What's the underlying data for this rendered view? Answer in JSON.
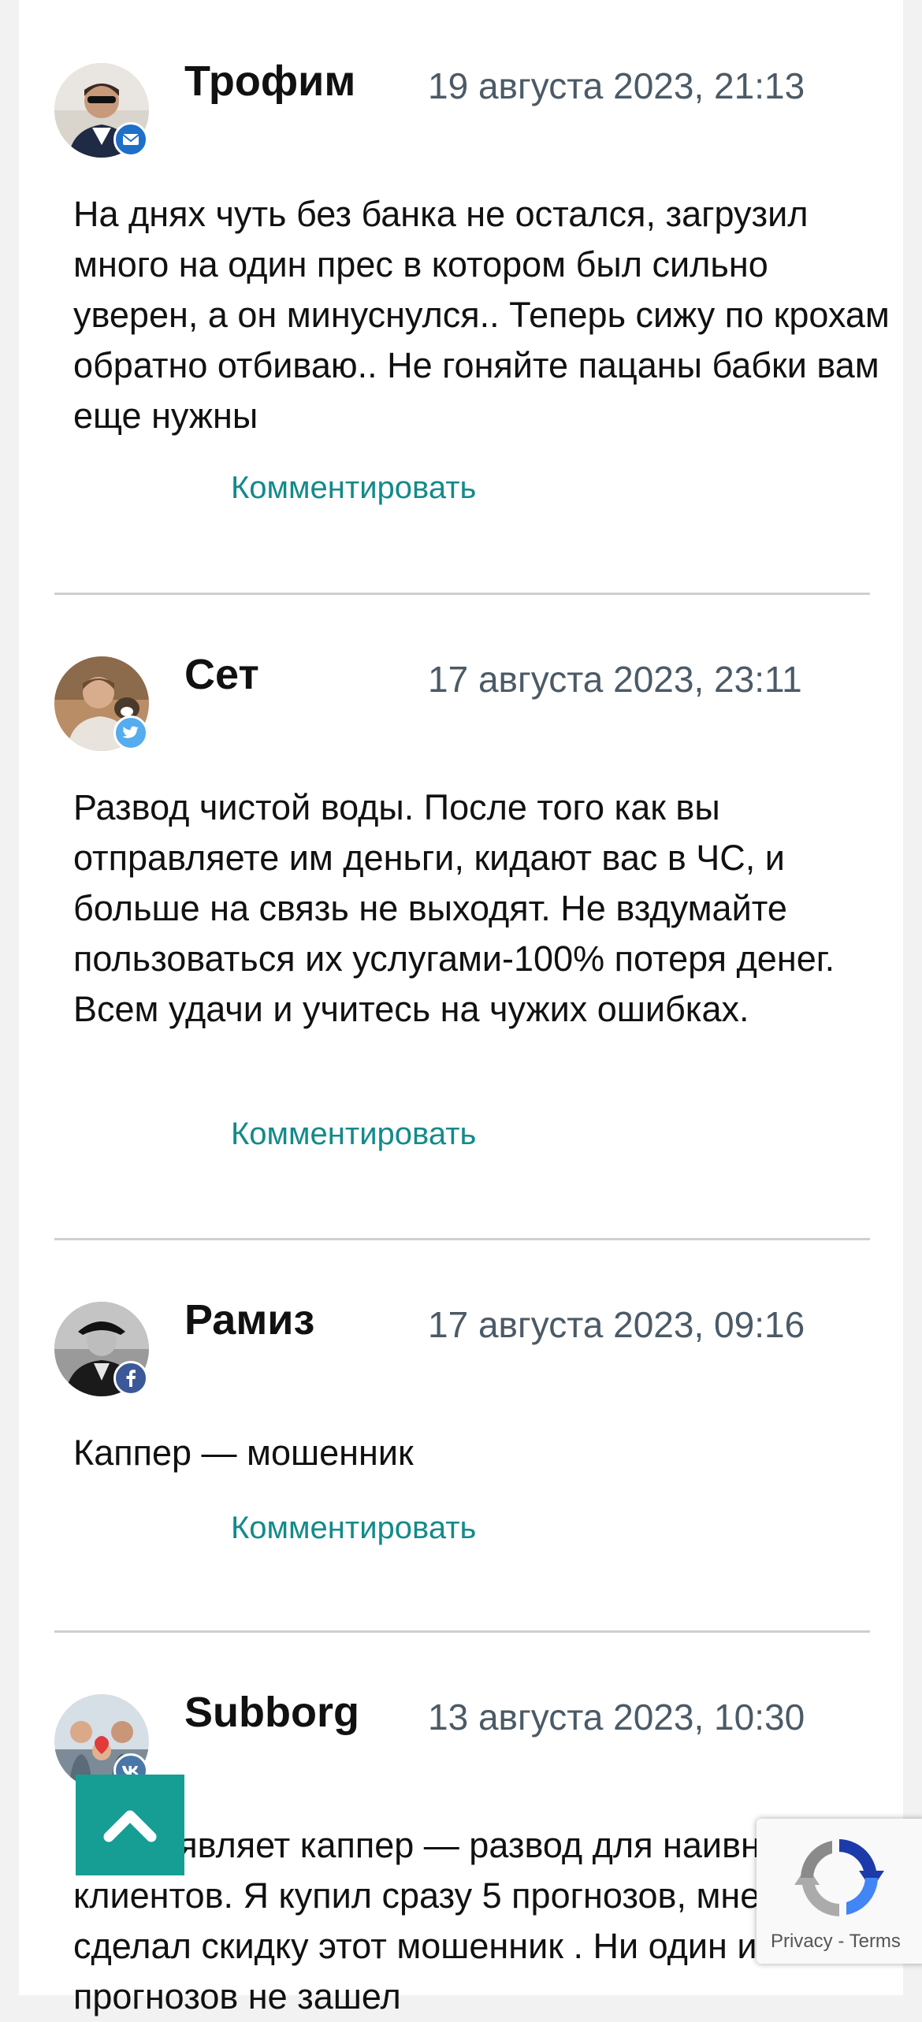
{
  "comments": [
    {
      "author": "Трофим",
      "date": "19 августа 2023, 21:13",
      "text": "На днях чуть без банка не остался, загрузил много на один прес в котором был сильно уверен, а он минуснулся.. Теперь сижу по крохам обратно отбиваю.. Не гоняйте пацаны бабки вам еще нужны",
      "reply_label": "Комментировать",
      "badge_icon": "mail-icon",
      "badge_color": "#1d6fc9"
    },
    {
      "author": "Сет",
      "date": "17 августа 2023, 23:11",
      "text": "Развод чистой воды. После того как вы отправляете им деньги, кидают вас в ЧС, и больше на связь не выходят. Не вздумайте пользоваться их услугами-100% потеря денег. Всем удачи и учитесь на чужих ошибках.",
      "reply_label": "Комментировать",
      "badge_icon": "twitter-icon",
      "badge_color": "#55acee"
    },
    {
      "author": "Рамиз",
      "date": "17 августа 2023, 09:16",
      "text": "Каппер — мошенник",
      "reply_label": "Комментировать",
      "badge_icon": "facebook-icon",
      "badge_color": "#3b5998"
    },
    {
      "author": "Subborg",
      "date": "13 августа 2023, 10:30",
      "text": "Что заявляет каппер — развод для наивных клиентов. Я купил сразу 5 прогнозов, мне, типа, сделал скидку этот мошенник . Ни один из прогнозов не зашел",
      "badge_icon": "vk-icon",
      "badge_color": "#4a76a8"
    }
  ],
  "scroll_top": {
    "icon": "chevron-up-icon",
    "color": "#169e94"
  },
  "recaptcha": {
    "privacy": "Privacy",
    "separator": "-",
    "terms": "Terms"
  },
  "colors": {
    "accent": "#138a8a",
    "date": "#4b5a66",
    "divider": "#cfcfcf"
  }
}
